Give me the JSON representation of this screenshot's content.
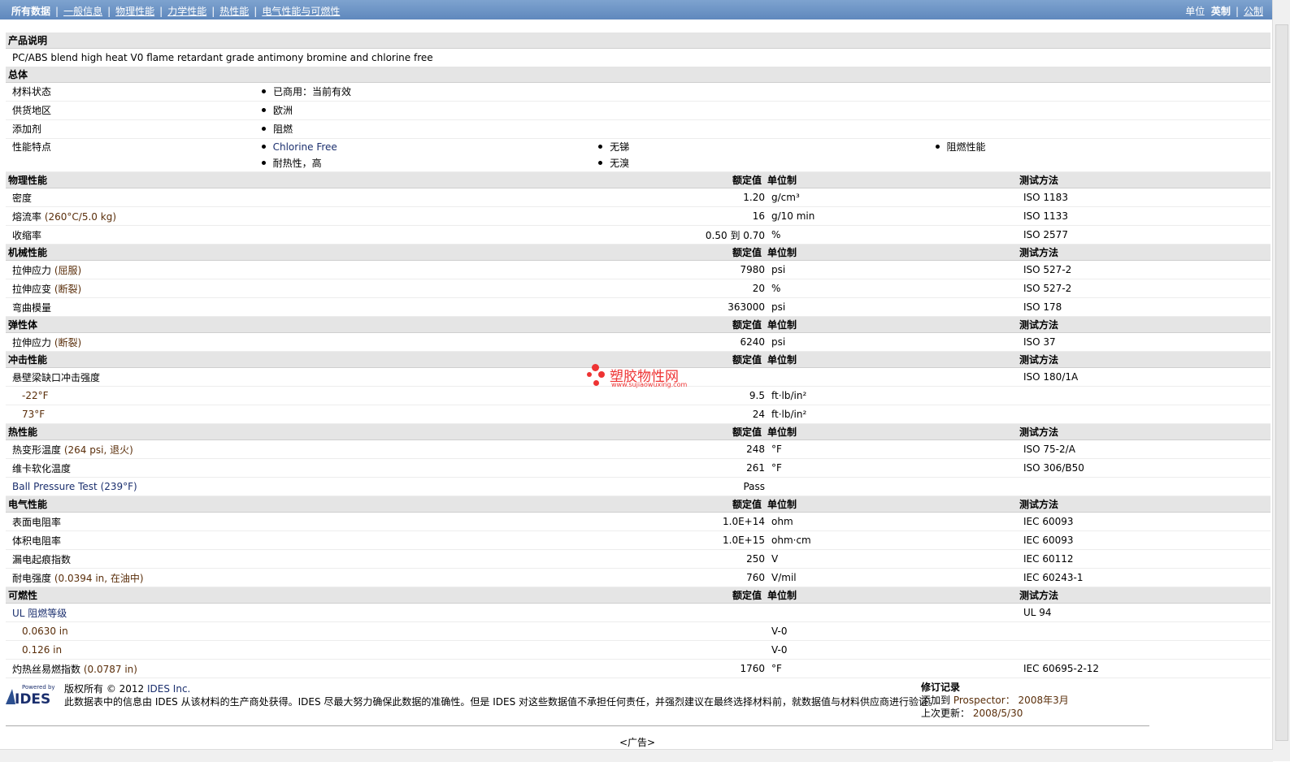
{
  "nav": {
    "tabs": [
      {
        "label": "所有数据"
      },
      {
        "label": "一般信息"
      },
      {
        "label": "物理性能"
      },
      {
        "label": "力学性能"
      },
      {
        "label": "热性能"
      },
      {
        "label": "电气性能与可燃性"
      }
    ],
    "units_label": "单位",
    "units_imperial": "英制",
    "units_metric": "公制"
  },
  "description": {
    "header": "产品说明",
    "text": "PC/ABS blend high heat V0 flame retardant grade antimony bromine and chlorine free"
  },
  "general": {
    "header": "总体",
    "rows": [
      {
        "label": "材料状态",
        "values": [
          "已商用：当前有效"
        ]
      },
      {
        "label": "供货地区",
        "values": [
          "欧洲"
        ]
      },
      {
        "label": "添加剂",
        "values": [
          "阻燃"
        ]
      }
    ],
    "features": {
      "label": "性能特点",
      "col1": [
        "Chlorine Free",
        "耐热性，高"
      ],
      "col2": [
        "无锑",
        "无溴"
      ],
      "col3": [
        "阻燃性能"
      ]
    }
  },
  "col_headers": {
    "value": "额定值",
    "unit": "单位制",
    "test": "测试方法"
  },
  "sections": [
    {
      "title": "物理性能",
      "rows": [
        {
          "name": "密度",
          "value": "1.20",
          "unit": "g/cm³",
          "test": "ISO 1183"
        },
        {
          "name": "熔流率",
          "cond": "(260°C/5.0 kg)",
          "value": "16",
          "unit": "g/10 min",
          "test": "ISO 1133"
        },
        {
          "name": "收缩率",
          "value": "0.50 到  0.70",
          "unit": "%",
          "test": "ISO 2577"
        }
      ]
    },
    {
      "title": "机械性能",
      "rows": [
        {
          "name": "拉伸应力",
          "cond": "(屈服)",
          "value": "7980",
          "unit": "psi",
          "test": "ISO 527-2"
        },
        {
          "name": "拉伸应变",
          "cond": "(断裂)",
          "value": "20",
          "unit": "%",
          "test": "ISO 527-2"
        },
        {
          "name": "弯曲模量",
          "value": "363000",
          "unit": "psi",
          "test": "ISO 178"
        }
      ]
    },
    {
      "title": "弹性体",
      "rows": [
        {
          "name": "拉伸应力",
          "cond": "(断裂)",
          "value": "6240",
          "unit": "psi",
          "test": "ISO 37"
        }
      ]
    },
    {
      "title": "冲击性能",
      "rows": [
        {
          "name": "悬壁梁缺口冲击强度",
          "value": "",
          "unit": "",
          "test": "ISO 180/1A"
        },
        {
          "name": "-22°F",
          "sub": true,
          "value": "9.5",
          "unit": "ft·lb/in²",
          "test": ""
        },
        {
          "name": "73°F",
          "sub": true,
          "value": "24",
          "unit": "ft·lb/in²",
          "test": ""
        }
      ]
    },
    {
      "title": "热性能",
      "rows": [
        {
          "name": "热变形温度",
          "cond": "(264 psi, 退火)",
          "value": "248",
          "unit": "°F",
          "test": "ISO 75-2/A"
        },
        {
          "name": "维卡软化温度",
          "value": "261",
          "unit": "°F",
          "test": "ISO 306/B50"
        },
        {
          "name": "Ball Pressure Test (239°F)",
          "value": "Pass",
          "unit": "",
          "test": ""
        }
      ]
    },
    {
      "title": "电气性能",
      "rows": [
        {
          "name": "表面电阻率",
          "value": "1.0E+14",
          "unit": "ohm",
          "test": "IEC 60093"
        },
        {
          "name": "体积电阻率",
          "value": "1.0E+15",
          "unit": "ohm·cm",
          "test": "IEC 60093"
        },
        {
          "name": "漏电起痕指数",
          "value": "250",
          "unit": "V",
          "test": "IEC 60112"
        },
        {
          "name": "耐电强度",
          "cond": "(0.0394 in, 在油中)",
          "value": "760",
          "unit": "V/mil",
          "test": "IEC 60243-1"
        }
      ]
    },
    {
      "title": "可燃性",
      "rows": [
        {
          "name": "UL 阻燃等级",
          "value": "",
          "unit": "",
          "test": "UL 94"
        },
        {
          "name": "0.0630 in",
          "sub": true,
          "value": "",
          "unit": "V-0",
          "test": ""
        },
        {
          "name": "0.126 in",
          "sub": true,
          "value": "",
          "unit": "V-0",
          "test": ""
        },
        {
          "name": "灼热丝易燃指数",
          "cond": "(0.0787 in)",
          "value": "1760",
          "unit": "°F",
          "test": "IEC 60695-2-12"
        }
      ]
    }
  ],
  "watermark": {
    "text": "塑胶物性网",
    "sub": "www.sujiaowuxing.com"
  },
  "footer": {
    "logo_top": "Powered by",
    "logo_text": "IDES",
    "copyright": "版权所有 © 2012",
    "company": "IDES Inc.",
    "disclaimer": "此数据表中的信息由 IDES 从该材料的生产商处获得。IDES 尽最大努力确保此数据的准确性。但是 IDES 对这些数据值不承担任何责任，并强烈建议在最终选择材料前，就数据值与材料供应商进行验证。",
    "rev_title": "修订记录",
    "added_label": "添加到",
    "added_where": "Prospector：",
    "added_date": "2008年3月",
    "updated_label": "上次更新：",
    "updated_date": "2008/5/30"
  },
  "ad": "<广告>"
}
